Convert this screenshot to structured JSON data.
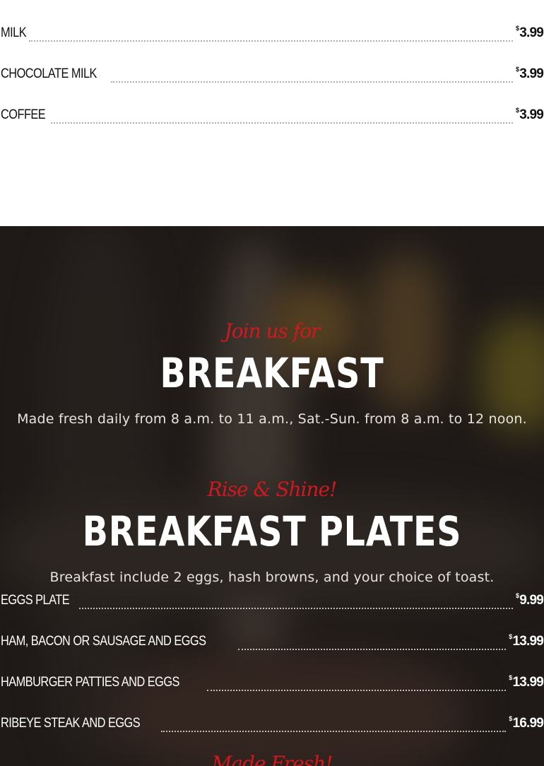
{
  "drinks": {
    "items": [
      {
        "name": "MILK",
        "currency": "$",
        "price": "3.99"
      },
      {
        "name": "CHOCOLATE MILK",
        "currency": "$",
        "price": "3.99"
      },
      {
        "name": "COFFEE",
        "currency": "$",
        "price": "3.99"
      }
    ]
  },
  "breakfast": {
    "script": "Join us for",
    "title": "BREAKFAST",
    "hours": "Made fresh daily from 8 a.m. to 11 a.m., Sat.-Sun. from 8 a.m. to 12 noon."
  },
  "plates": {
    "script": "Rise & Shine!",
    "title": "BREAKFAST PLATES",
    "description": "Breakfast include 2 eggs, hash browns, and your choice of toast.",
    "items": [
      {
        "name": "EGGS PLATE",
        "currency": "$",
        "price": "9.99"
      },
      {
        "name": "HAM, BACON OR SAUSAGE AND EGGS",
        "currency": "$",
        "price": "13.99"
      },
      {
        "name": "HAMBURGER PATTIES AND EGGS",
        "currency": "$",
        "price": "13.99"
      },
      {
        "name": "RIBEYE STEAK AND EGGS",
        "currency": "$",
        "price": "16.99"
      }
    ]
  },
  "next_section": {
    "script": "Made Fresh!"
  },
  "colors": {
    "accent": "#d0181e",
    "dark_bg": "#2d2623",
    "text_dark": "#111111",
    "text_light": "#ffffff"
  }
}
